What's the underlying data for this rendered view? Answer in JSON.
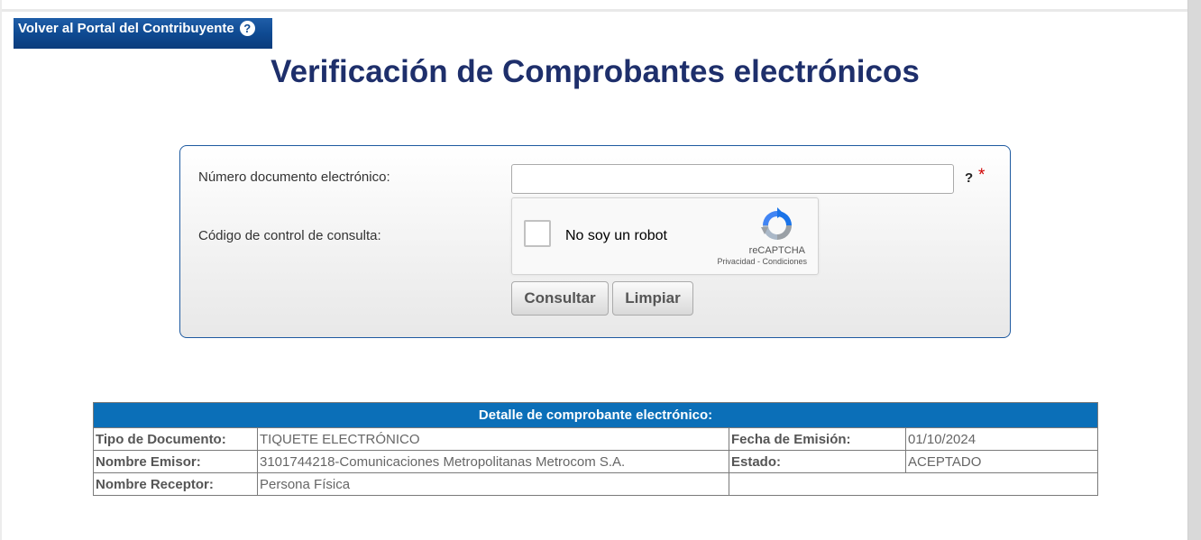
{
  "header": {
    "back_portal_label": "Volver al Portal del Contribuyente",
    "help_glyph": "?",
    "page_title": "Verificación de Comprobantes electrónicos"
  },
  "form": {
    "document_number_label": "Número documento electrónico:",
    "document_number_value": "",
    "help_q": "?",
    "required_mark": "*",
    "control_code_label": "Código de control de consulta:",
    "recaptcha": {
      "checkbox_label": "No soy un robot",
      "brand": "reCAPTCHA",
      "links": "Privacidad - Condiciones"
    },
    "consultar_label": "Consultar",
    "limpiar_label": "Limpiar"
  },
  "detail": {
    "title": "Detalle de comprobante electrónico:",
    "rows": [
      {
        "k1": "Tipo de Documento:",
        "v1": "TIQUETE ELECTRÓNICO",
        "k2": "Fecha de Emisión:",
        "v2": "01/10/2024"
      },
      {
        "k1": "Nombre Emisor:",
        "v1": "3101744218-Comunicaciones Metropolitanas Metrocom S.A.",
        "k2": "Estado:",
        "v2": "ACEPTADO"
      },
      {
        "k1": "Nombre Receptor:",
        "v1": "Persona Física"
      }
    ]
  },
  "colors": {
    "title_navy": "#1e2f6b",
    "table_header_blue": "#0b6fb8",
    "portal_button_blue": "#0f4a92",
    "required_red": "#d00000"
  },
  "icons": [
    "help-circle-icon",
    "recaptcha-logo-icon"
  ]
}
